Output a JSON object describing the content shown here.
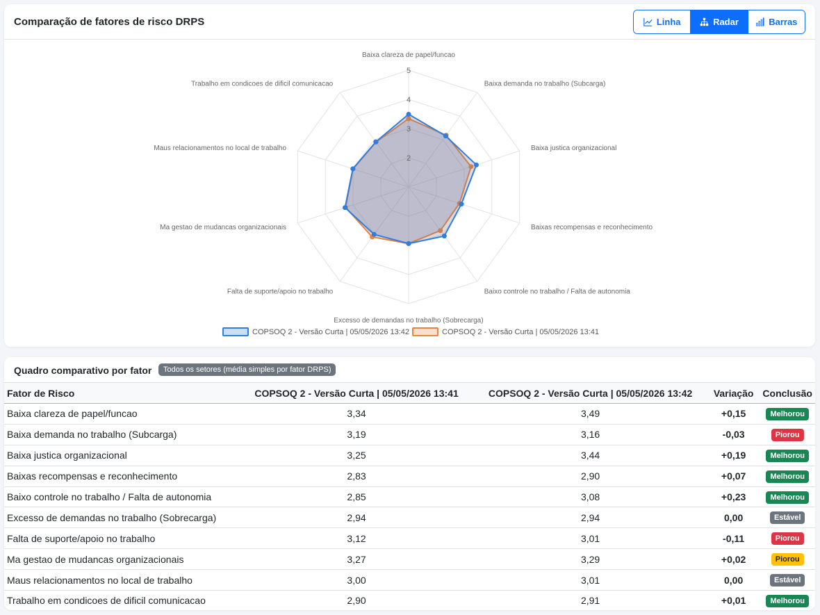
{
  "chart_panel": {
    "title": "Comparação de fatores de risco DRPS",
    "toggle": [
      {
        "label": "Linha",
        "icon": "line-chart-icon",
        "active": false
      },
      {
        "label": "Radar",
        "icon": "sitemap-icon",
        "active": true
      },
      {
        "label": "Barras",
        "icon": "bar-chart-icon",
        "active": false
      }
    ]
  },
  "chart_data": {
    "type": "radar",
    "categories": [
      "Baixa clareza de papel/funcao",
      "Baixa demanda no trabalho (Subcarga)",
      "Baixa justica organizacional",
      "Baixas recompensas e reconhecimento",
      "Baixo controle no trabalho / Falta de autonomia",
      "Excesso de demandas no trabalho (Sobrecarga)",
      "Falta de suporte/apoio no trabalho",
      "Ma gestao de mudancas organizacionais",
      "Maus relacionamentos no local de trabalho",
      "Trabalho em condicoes de dificil comunicacao"
    ],
    "series": [
      {
        "name": "COPSOQ 2 - Versão Curta | 05/05/2026 13:42",
        "color": "#2f7de1",
        "values": [
          3.49,
          3.16,
          3.44,
          2.9,
          3.08,
          2.94,
          3.01,
          3.29,
          3.01,
          2.91
        ]
      },
      {
        "name": "COPSOQ 2 - Versão Curta | 05/05/2026 13:41",
        "color": "#e8843c",
        "values": [
          3.34,
          3.19,
          3.25,
          2.83,
          2.85,
          2.94,
          3.12,
          3.27,
          3.0,
          2.9
        ]
      }
    ],
    "r_ticks": [
      "2",
      "3",
      "4",
      "5"
    ],
    "rlim": [
      1,
      5
    ],
    "legend": "bottom"
  },
  "table_panel": {
    "title": "Quadro comparativo por fator",
    "badge": "Todos os setores (média simples por fator DRPS)",
    "headers": {
      "factor": "Fator de Risco",
      "a": "COPSOQ 2 - Versão Curta | 05/05/2026 13:41",
      "b": "COPSOQ 2 - Versão Curta | 05/05/2026 13:42",
      "variation": "Variação",
      "conclusion": "Conclusão"
    },
    "rows": [
      {
        "factor": "Baixa clareza de papel/funcao",
        "a": "3,34",
        "b": "3,49",
        "variation": "+0,15",
        "conclusion": "Melhorou",
        "color": "#198754",
        "text_color": "#ffffff"
      },
      {
        "factor": "Baixa demanda no trabalho (Subcarga)",
        "a": "3,19",
        "b": "3,16",
        "variation": "-0,03",
        "conclusion": "Piorou",
        "color": "#dc3545",
        "text_color": "#ffffff"
      },
      {
        "factor": "Baixa justica organizacional",
        "a": "3,25",
        "b": "3,44",
        "variation": "+0,19",
        "conclusion": "Melhorou",
        "color": "#198754",
        "text_color": "#ffffff"
      },
      {
        "factor": "Baixas recompensas e reconhecimento",
        "a": "2,83",
        "b": "2,90",
        "variation": "+0,07",
        "conclusion": "Melhorou",
        "color": "#198754",
        "text_color": "#ffffff"
      },
      {
        "factor": "Baixo controle no trabalho / Falta de autonomia",
        "a": "2,85",
        "b": "3,08",
        "variation": "+0,23",
        "conclusion": "Melhorou",
        "color": "#198754",
        "text_color": "#ffffff"
      },
      {
        "factor": "Excesso de demandas no trabalho (Sobrecarga)",
        "a": "2,94",
        "b": "2,94",
        "variation": "0,00",
        "conclusion": "Estável",
        "color": "#6c757d",
        "text_color": "#ffffff"
      },
      {
        "factor": "Falta de suporte/apoio no trabalho",
        "a": "3,12",
        "b": "3,01",
        "variation": "-0,11",
        "conclusion": "Piorou",
        "color": "#dc3545",
        "text_color": "#ffffff"
      },
      {
        "factor": "Ma gestao de mudancas organizacionais",
        "a": "3,27",
        "b": "3,29",
        "variation": "+0,02",
        "conclusion": "Piorou",
        "color": "#ffc107",
        "text_color": "#212529"
      },
      {
        "factor": "Maus relacionamentos no local de trabalho",
        "a": "3,00",
        "b": "3,01",
        "variation": "0,00",
        "conclusion": "Estável",
        "color": "#6c757d",
        "text_color": "#ffffff"
      },
      {
        "factor": "Trabalho em condicoes de dificil comunicacao",
        "a": "2,90",
        "b": "2,91",
        "variation": "+0,01",
        "conclusion": "Melhorou",
        "color": "#198754",
        "text_color": "#ffffff"
      }
    ]
  }
}
